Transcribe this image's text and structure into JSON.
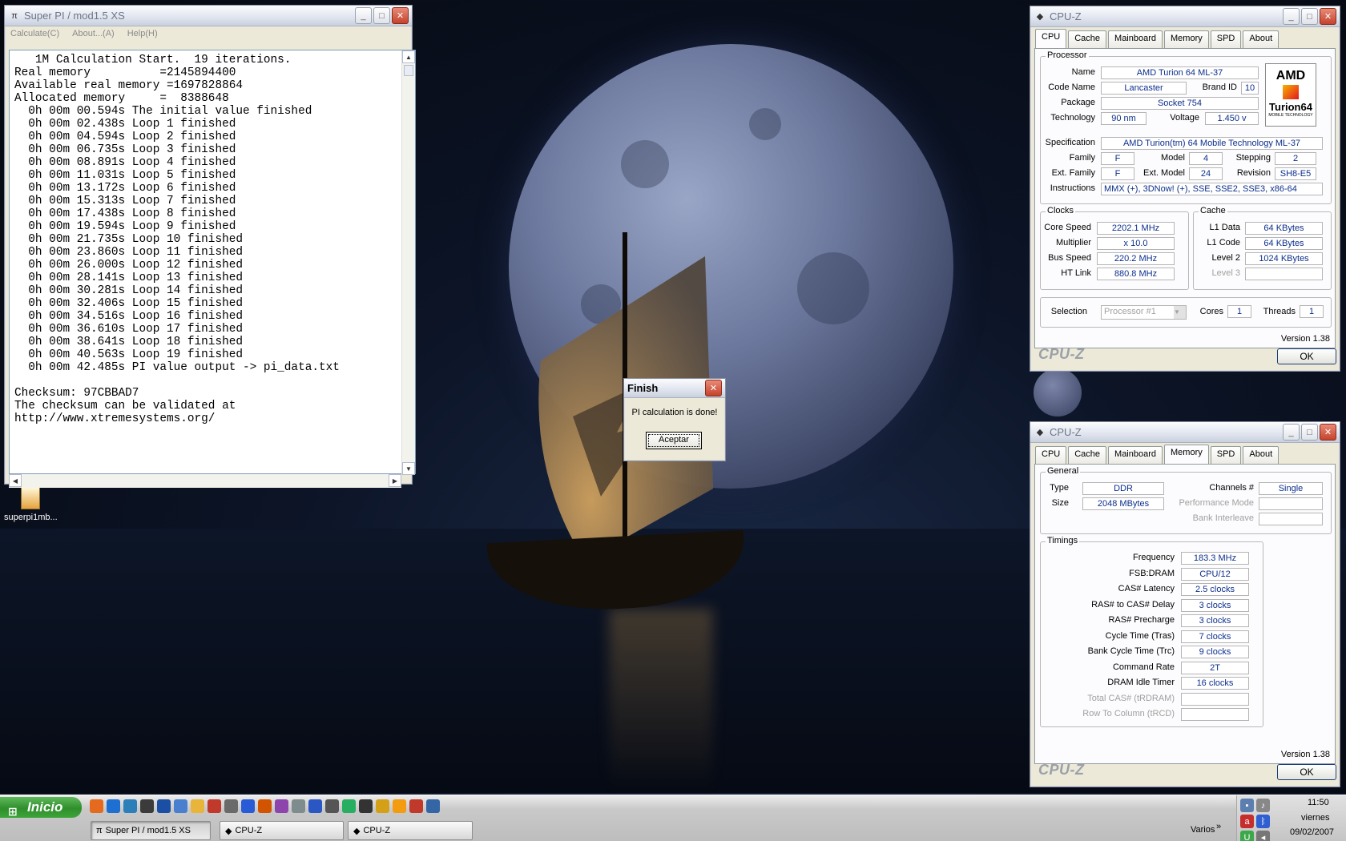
{
  "superpi": {
    "title": "Super PI / mod1.5 XS",
    "menu": [
      "Calculate(C)",
      "About...(A)",
      "Help(H)"
    ],
    "console_lines": [
      "   1M Calculation Start.  19 iterations.",
      "Real memory          =2145894400",
      "Available real memory =1697828864",
      "Allocated memory     =  8388648",
      "  0h 00m 00.594s The initial value finished",
      "  0h 00m 02.438s Loop 1 finished",
      "  0h 00m 04.594s Loop 2 finished",
      "  0h 00m 06.735s Loop 3 finished",
      "  0h 00m 08.891s Loop 4 finished",
      "  0h 00m 11.031s Loop 5 finished",
      "  0h 00m 13.172s Loop 6 finished",
      "  0h 00m 15.313s Loop 7 finished",
      "  0h 00m 17.438s Loop 8 finished",
      "  0h 00m 19.594s Loop 9 finished",
      "  0h 00m 21.735s Loop 10 finished",
      "  0h 00m 23.860s Loop 11 finished",
      "  0h 00m 26.000s Loop 12 finished",
      "  0h 00m 28.141s Loop 13 finished",
      "  0h 00m 30.281s Loop 14 finished",
      "  0h 00m 32.406s Loop 15 finished",
      "  0h 00m 34.516s Loop 16 finished",
      "  0h 00m 36.610s Loop 17 finished",
      "  0h 00m 38.641s Loop 18 finished",
      "  0h 00m 40.563s Loop 19 finished",
      "  0h 00m 42.485s PI value output -> pi_data.txt",
      "",
      "Checksum: 97CBBAD7",
      "The checksum can be validated at",
      "http://www.xtremesystems.org/"
    ]
  },
  "finish_dialog": {
    "title": "Finish",
    "message": "PI calculation is done!",
    "button": "Aceptar"
  },
  "desktop_icon": {
    "label": "superpi1mb..."
  },
  "cpuz_cpu": {
    "title": "CPU-Z",
    "tabs": [
      "CPU",
      "Cache",
      "Mainboard",
      "Memory",
      "SPD",
      "About"
    ],
    "active_tab": "CPU",
    "processor": {
      "group": "Processor",
      "name_label": "Name",
      "name": "AMD Turion 64 ML-37",
      "codename_label": "Code Name",
      "codename": "Lancaster",
      "brandid_label": "Brand ID",
      "brandid": "10",
      "package_label": "Package",
      "package": "Socket 754",
      "tech_label": "Technology",
      "technology": "90 nm",
      "voltage_label": "Voltage",
      "voltage": "1.450 v",
      "spec_label": "Specification",
      "specification": "AMD Turion(tm) 64 Mobile Technology ML-37",
      "family_label": "Family",
      "family": "F",
      "model_label": "Model",
      "model": "4",
      "stepping_label": "Stepping",
      "stepping": "2",
      "extfamily_label": "Ext. Family",
      "ext_family": "F",
      "extmodel_label": "Ext. Model",
      "ext_model": "24",
      "revision_label": "Revision",
      "revision": "SH8-E5",
      "instr_label": "Instructions",
      "instructions": "MMX (+), 3DNow! (+), SSE, SSE2, SSE3, x86-64",
      "logo_brand": "AMD",
      "logo_product": "Turion64",
      "logo_sub": "MOBILE TECHNOLOGY"
    },
    "clocks": {
      "group": "Clocks",
      "core_label": "Core Speed",
      "core_speed": "2202.1 MHz",
      "mult_label": "Multiplier",
      "multiplier": "x 10.0",
      "bus_label": "Bus Speed",
      "bus_speed": "220.2 MHz",
      "ht_label": "HT Link",
      "ht_link": "880.8 MHz"
    },
    "cache": {
      "group": "Cache",
      "l1d_label": "L1 Data",
      "l1_data": "64 KBytes",
      "l1c_label": "L1 Code",
      "l1_code": "64 KBytes",
      "l2_label": "Level 2",
      "level2": "1024 KBytes",
      "l3_label": "Level 3",
      "level3": ""
    },
    "selection": {
      "label": "Selection",
      "value": "Processor #1",
      "cores_label": "Cores",
      "cores": "1",
      "threads_label": "Threads",
      "threads": "1"
    },
    "version": "Version 1.38",
    "logo": "CPU-Z",
    "ok": "OK"
  },
  "cpuz_mem": {
    "title": "CPU-Z",
    "tabs": [
      "CPU",
      "Cache",
      "Mainboard",
      "Memory",
      "SPD",
      "About"
    ],
    "active_tab": "Memory",
    "general": {
      "group": "General",
      "type_label": "Type",
      "type": "DDR",
      "size_label": "Size",
      "size": "2048 MBytes",
      "channels_label": "Channels #",
      "channels": "Single",
      "perf_label": "Performance Mode",
      "perf_mode": "",
      "bank_label": "Bank Interleave",
      "bank_interleave": ""
    },
    "timings": {
      "group": "Timings",
      "rows": [
        {
          "label": "Frequency",
          "value": "183.3 MHz",
          "dim": false
        },
        {
          "label": "FSB:DRAM",
          "value": "CPU/12",
          "dim": false
        },
        {
          "label": "CAS# Latency",
          "value": "2.5 clocks",
          "dim": false
        },
        {
          "label": "RAS# to CAS# Delay",
          "value": "3 clocks",
          "dim": false
        },
        {
          "label": "RAS# Precharge",
          "value": "3 clocks",
          "dim": false
        },
        {
          "label": "Cycle Time (Tras)",
          "value": "7 clocks",
          "dim": false
        },
        {
          "label": "Bank Cycle Time (Trc)",
          "value": "9 clocks",
          "dim": false
        },
        {
          "label": "Command Rate",
          "value": "2T",
          "dim": false
        },
        {
          "label": "DRAM Idle Timer",
          "value": "16 clocks",
          "dim": false
        },
        {
          "label": "Total CAS# (tRDRAM)",
          "value": "",
          "dim": true
        },
        {
          "label": "Row To Column (tRCD)",
          "value": "",
          "dim": true
        }
      ]
    },
    "version": "Version 1.38",
    "logo": "CPU-Z",
    "ok": "OK"
  },
  "taskbar": {
    "start_label": "Inicio",
    "quicklaunch_icons": [
      "firefox-icon",
      "ie-icon",
      "outlook-icon",
      "media-icon",
      "globe-icon",
      "network-icon",
      "folder-icon",
      "game-icon",
      "cpu-icon",
      "flash-icon",
      "paint-icon",
      "disc-icon",
      "tool-icon",
      "font-icon",
      "skull-icon",
      "chip-icon",
      "cube-icon",
      "info-icon",
      "vlc-icon",
      "gift-icon",
      "player-icon"
    ],
    "tasks": [
      {
        "label": "Super PI / mod1.5 XS",
        "active": true
      },
      {
        "label": "CPU-Z",
        "active": false
      },
      {
        "label": "CPU-Z",
        "active": false
      }
    ],
    "toolbar_label": "Varios",
    "clock_time": "11:50",
    "clock_day": "viernes",
    "clock_date": "09/02/2007"
  }
}
